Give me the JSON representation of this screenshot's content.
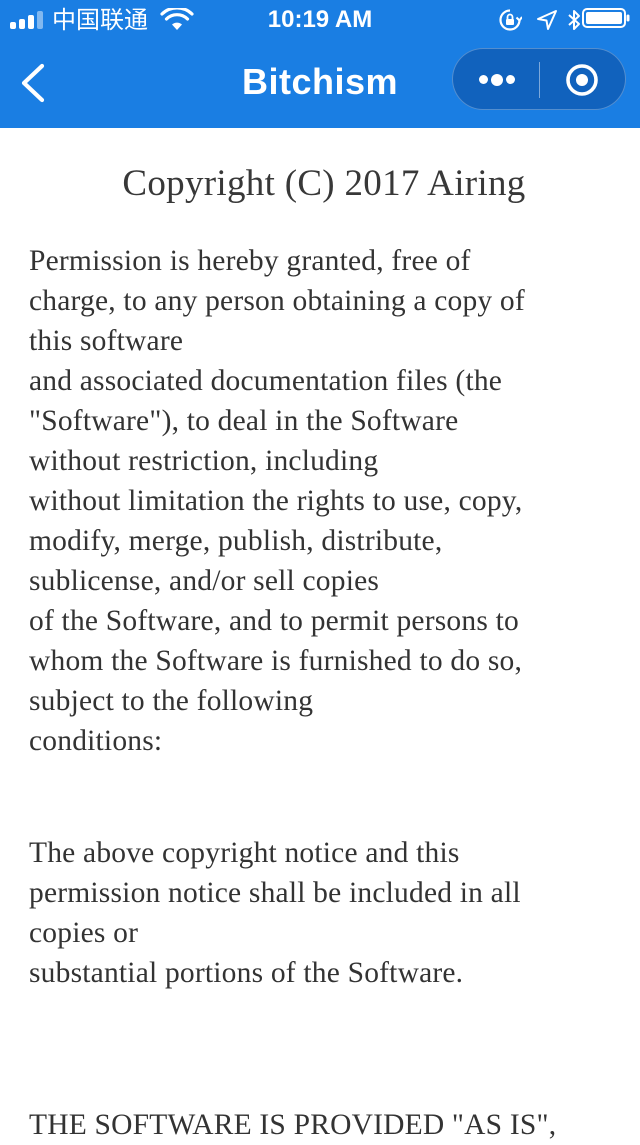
{
  "status_bar": {
    "carrier": "中国联通",
    "time": "10:19 AM"
  },
  "nav": {
    "title": "Bitchism"
  },
  "icons": {
    "back": "chevron-left-icon",
    "more": "more-dots-icon",
    "close": "target-circle-icon",
    "signal": "signal-bars-icon",
    "wifi": "wifi-icon",
    "lock": "orientation-lock-icon",
    "location": "location-arrow-icon",
    "bluetooth": "bluetooth-icon",
    "battery": "battery-icon"
  },
  "colors": {
    "nav_background": "#1a7ee3",
    "text": "#333333",
    "background": "#ffffff"
  },
  "document": {
    "title": "Copyright (C) 2017 Airing",
    "paragraph1": [
      "Permission is hereby granted, free of",
      "charge, to any person obtaining a copy of",
      "this software",
      "and associated documentation files (the",
      "\"Software\"), to deal in the Software",
      "without restriction, including",
      "without limitation the rights to use, copy,",
      "modify, merge, publish, distribute,",
      "sublicense, and/or sell copies",
      "of the Software, and to permit persons to",
      "whom the Software is furnished to do so,",
      "subject to the following",
      "conditions:"
    ],
    "paragraph2": [
      "The above copyright notice and this",
      "permission notice shall be included in all",
      "copies or",
      "substantial portions of the Software."
    ],
    "paragraph3": [
      "THE SOFTWARE IS PROVIDED \"AS IS\","
    ]
  }
}
